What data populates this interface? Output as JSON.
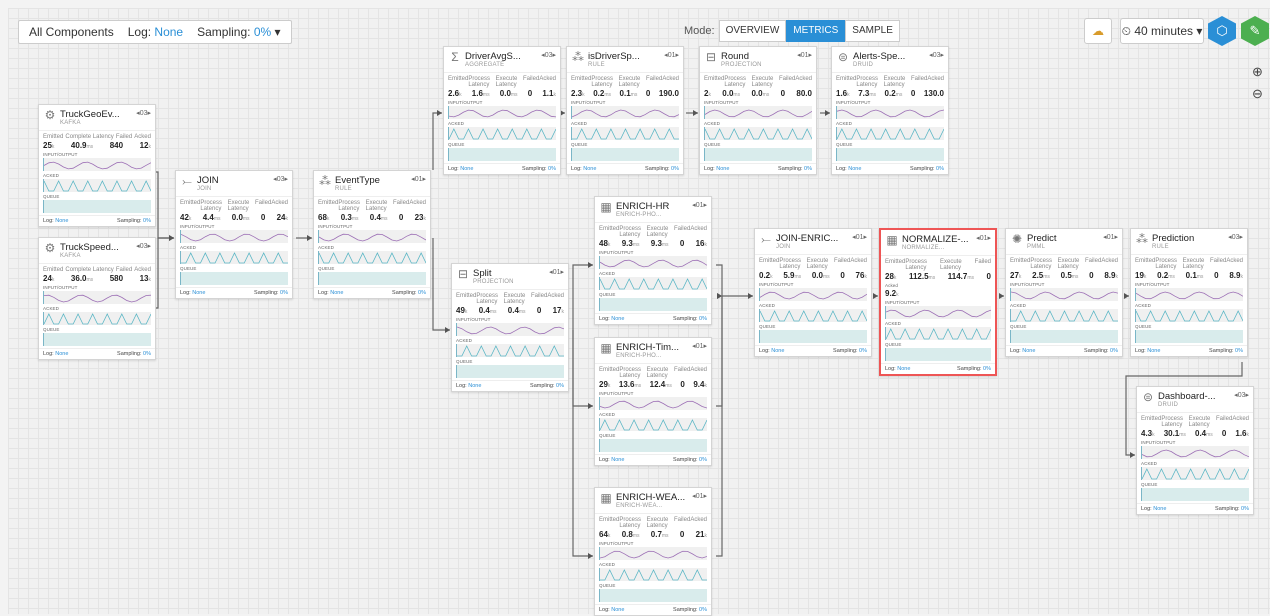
{
  "toolbar": {
    "components_label": "All Components",
    "log_label": "Log:",
    "log_value": "None",
    "sampling_label": "Sampling:",
    "sampling_value": "0%",
    "mode_label": "Mode:",
    "modes": [
      "OVERVIEW",
      "METRICS",
      "SAMPLE"
    ],
    "active_mode": "METRICS",
    "time_range": "40 minutes"
  },
  "nodes": [
    {
      "title": "TruckGeoEv...",
      "type": "KAFKA",
      "icon": "kafka-icon",
      "parallelism": "03",
      "headers": [
        "Emitted",
        "Complete Latency",
        "Failed",
        "Acked"
      ],
      "values": [
        "25",
        "40.9",
        "840",
        "12"
      ],
      "units": [
        "k",
        "ms",
        "",
        "k"
      ],
      "log": "None",
      "sampling": "0%"
    },
    {
      "title": "TruckSpeed...",
      "type": "KAFKA",
      "icon": "kafka-icon",
      "parallelism": "03",
      "headers": [
        "Emitted",
        "Complete Latency",
        "Failed",
        "Acked"
      ],
      "values": [
        "24",
        "36.0",
        "580",
        "13"
      ],
      "units": [
        "k",
        "ms",
        "",
        "k"
      ],
      "log": "None",
      "sampling": "0%"
    },
    {
      "title": "JOIN",
      "type": "JOIN",
      "icon": "join-icon",
      "parallelism": "03",
      "headers": [
        "Emitted",
        "Process Latency",
        "Execute Latency",
        "Failed",
        "Acked"
      ],
      "values": [
        "42",
        "4.4",
        "0.0",
        "0",
        "24"
      ],
      "units": [
        "k",
        "ms",
        "ms",
        "",
        "k"
      ],
      "log": "None",
      "sampling": "0%"
    },
    {
      "title": "EventType",
      "type": "RULE",
      "icon": "rule-icon",
      "parallelism": "01",
      "headers": [
        "Emitted",
        "Process Latency",
        "Execute Latency",
        "Failed",
        "Acked"
      ],
      "values": [
        "68",
        "0.3",
        "0.4",
        "0",
        "23"
      ],
      "units": [
        "k",
        "ms",
        "ms",
        "",
        "k"
      ],
      "log": "None",
      "sampling": "0%"
    },
    {
      "title": "DriverAvgS...",
      "type": "AGGREGATE",
      "icon": "aggregate-icon",
      "parallelism": "03",
      "headers": [
        "Emitted",
        "Process Latency",
        "Execute Latency",
        "Failed",
        "Acked"
      ],
      "values": [
        "2.6",
        "1.6",
        "0.0",
        "0",
        "1.1"
      ],
      "units": [
        "k",
        "ms",
        "ms",
        "",
        "k"
      ],
      "log": "None",
      "sampling": "0%"
    },
    {
      "title": "isDriverSp...",
      "type": "RULE",
      "icon": "rule-icon",
      "parallelism": "01",
      "headers": [
        "Emitted",
        "Process Latency",
        "Execute Latency",
        "Failed",
        "Acked"
      ],
      "values": [
        "2.3",
        "0.2",
        "0.1",
        "0",
        "190.0"
      ],
      "units": [
        "k",
        "ms",
        "ms",
        "",
        ""
      ],
      "log": "None",
      "sampling": "0%"
    },
    {
      "title": "Round",
      "type": "PROJECTION",
      "icon": "projection-icon",
      "parallelism": "01",
      "headers": [
        "Emitted",
        "Process Latency",
        "Execute Latency",
        "Failed",
        "Acked"
      ],
      "values": [
        "2",
        "0.0",
        "0.0",
        "0",
        "80.0"
      ],
      "units": [
        "k",
        "ms",
        "ms",
        "",
        ""
      ],
      "log": "None",
      "sampling": "0%"
    },
    {
      "title": "Alerts-Spe...",
      "type": "DRUID",
      "icon": "druid-icon",
      "parallelism": "03",
      "headers": [
        "Emitted",
        "Process Latency",
        "Execute Latency",
        "Failed",
        "Acked"
      ],
      "values": [
        "1.6",
        "7.3",
        "0.2",
        "0",
        "130.0"
      ],
      "units": [
        "k",
        "ms",
        "ms",
        "",
        ""
      ],
      "log": "None",
      "sampling": "0%"
    },
    {
      "title": "Split",
      "type": "PROJECTION",
      "icon": "projection-icon",
      "parallelism": "01",
      "headers": [
        "Emitted",
        "Process Latency",
        "Execute Latency",
        "Failed",
        "Acked"
      ],
      "values": [
        "49",
        "0.4",
        "0.4",
        "0",
        "17"
      ],
      "units": [
        "k",
        "ms",
        "ms",
        "",
        "k"
      ],
      "log": "None",
      "sampling": "0%"
    },
    {
      "title": "ENRICH-HR",
      "type": "ENRICH-PHO...",
      "icon": "enrich-icon",
      "parallelism": "01",
      "headers": [
        "Emitted",
        "Process Latency",
        "Execute Latency",
        "Failed",
        "Acked"
      ],
      "values": [
        "48",
        "9.3",
        "9.3",
        "0",
        "16"
      ],
      "units": [
        "k",
        "ms",
        "ms",
        "",
        "k"
      ],
      "log": "None",
      "sampling": "0%"
    },
    {
      "title": "ENRICH-Tim...",
      "type": "ENRICH-PHO...",
      "icon": "enrich-icon",
      "parallelism": "01",
      "headers": [
        "Emitted",
        "Process Latency",
        "Execute Latency",
        "Failed",
        "Acked"
      ],
      "values": [
        "29",
        "13.6",
        "12.4",
        "0",
        "9.4"
      ],
      "units": [
        "k",
        "ms",
        "ms",
        "",
        "k"
      ],
      "log": "None",
      "sampling": "0%"
    },
    {
      "title": "ENRICH-WEA...",
      "type": "ENRICH-WEA...",
      "icon": "enrich-icon",
      "parallelism": "01",
      "headers": [
        "Emitted",
        "Process Latency",
        "Execute Latency",
        "Failed",
        "Acked"
      ],
      "values": [
        "64",
        "0.8",
        "0.7",
        "0",
        "21"
      ],
      "units": [
        "k",
        "ms",
        "ms",
        "",
        "k"
      ],
      "log": "None",
      "sampling": "0%"
    },
    {
      "title": "JOIN-ENRIC...",
      "type": "JOIN",
      "icon": "join-icon",
      "parallelism": "01",
      "headers": [
        "Emitted",
        "Process Latency",
        "Execute Latency",
        "Failed",
        "Acked"
      ],
      "values": [
        "0.2",
        "5.9",
        "0.0",
        "0",
        "76"
      ],
      "units": [
        "k",
        "ms",
        "ms",
        "",
        "k"
      ],
      "log": "None",
      "sampling": "0%"
    },
    {
      "title": "NORMALIZE-...",
      "type": "NORMALIZE...",
      "icon": "normalize-icon",
      "parallelism": "01",
      "headers": [
        "Emitted",
        "Process Latency",
        "Execute Latency",
        "Failed"
      ],
      "values": [
        "28",
        "112.5",
        "114.7",
        "0"
      ],
      "units": [
        "k",
        "ms",
        "ms",
        ""
      ],
      "acked_label": "Acked",
      "acked": "9.2",
      "acked_unit": "k",
      "log": "None",
      "sampling": "0%"
    },
    {
      "title": "Predict",
      "type": "PMML",
      "icon": "pmml-icon",
      "parallelism": "01",
      "headers": [
        "Emitted",
        "Process Latency",
        "Execute Latency",
        "Failed",
        "Acked"
      ],
      "values": [
        "27",
        "2.5",
        "0.5",
        "0",
        "8.9"
      ],
      "units": [
        "k",
        "ms",
        "ms",
        "",
        "k"
      ],
      "log": "None",
      "sampling": "0%"
    },
    {
      "title": "Prediction",
      "type": "RULE",
      "icon": "rule-icon",
      "parallelism": "03",
      "headers": [
        "Emitted",
        "Process Latency",
        "Execute Latency",
        "Failed",
        "Acked"
      ],
      "values": [
        "19",
        "0.2",
        "0.1",
        "0",
        "8.9"
      ],
      "units": [
        "k",
        "ms",
        "ms",
        "",
        "k"
      ],
      "log": "None",
      "sampling": "0%"
    },
    {
      "title": "Dashboard-...",
      "type": "DRUID",
      "icon": "druid-icon",
      "parallelism": "03",
      "headers": [
        "Emitted",
        "Process Latency",
        "Execute Latency",
        "Failed",
        "Acked"
      ],
      "values": [
        "4.3",
        "30.1",
        "0.4",
        "0",
        "1.6"
      ],
      "units": [
        "k",
        "ms",
        "ms",
        "",
        "k"
      ],
      "log": "None",
      "sampling": "0%"
    }
  ],
  "chart_sections": [
    "INPUT/OUTPUT",
    "ACKED",
    "QUEUE"
  ],
  "footer": {
    "log_label": "Log:",
    "sampling_label": "Sampling:"
  }
}
